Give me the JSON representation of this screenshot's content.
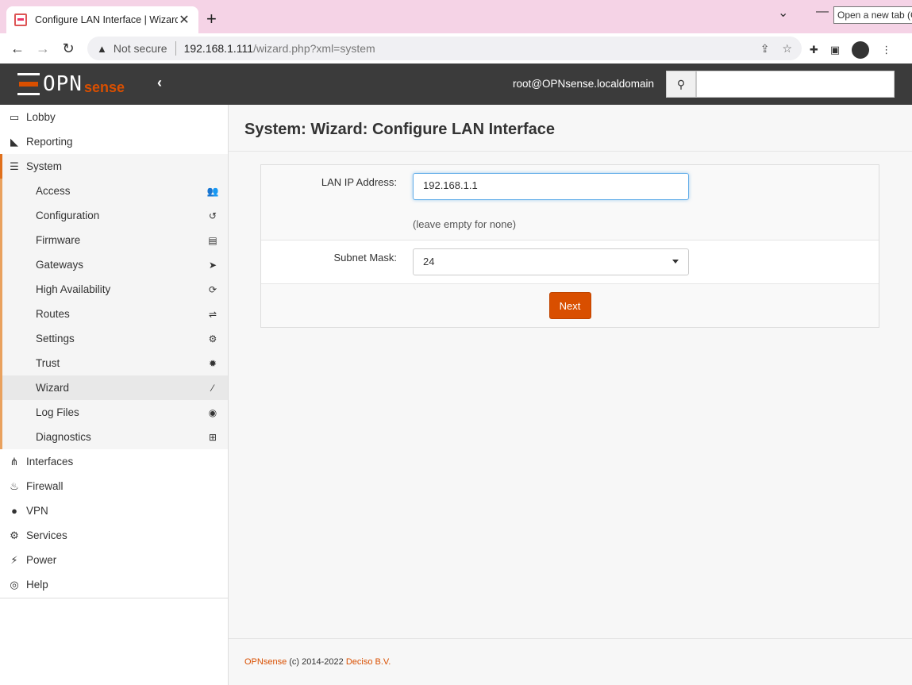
{
  "browser": {
    "tab_title": "Configure LAN Interface | Wizard",
    "tooltip": "Open a new tab (Ctrl+T)",
    "url_security": "Not secure",
    "url_host": "192.168.1.111",
    "url_path": "/wizard.php?xml=system"
  },
  "header": {
    "logo_opn": "OPN",
    "logo_sense": "sense",
    "user": "root@OPNsense.localdomain",
    "search_placeholder": ""
  },
  "sidebar": {
    "top_items": [
      {
        "label": "Lobby",
        "icon": "laptop-icon"
      },
      {
        "label": "Reporting",
        "icon": "area-chart-icon"
      },
      {
        "label": "System",
        "icon": "server-icon"
      }
    ],
    "system_subitems": [
      {
        "label": "Access",
        "icon": "users-icon"
      },
      {
        "label": "Configuration",
        "icon": "history-icon"
      },
      {
        "label": "Firmware",
        "icon": "building-icon"
      },
      {
        "label": "Gateways",
        "icon": "location-arrow-icon"
      },
      {
        "label": "High Availability",
        "icon": "refresh-icon"
      },
      {
        "label": "Routes",
        "icon": "map-signs-icon"
      },
      {
        "label": "Settings",
        "icon": "cogs-icon"
      },
      {
        "label": "Trust",
        "icon": "certificate-icon"
      },
      {
        "label": "Wizard",
        "icon": "magic-icon"
      },
      {
        "label": "Log Files",
        "icon": "eye-icon"
      },
      {
        "label": "Diagnostics",
        "icon": "medkit-icon"
      }
    ],
    "bottom_items": [
      {
        "label": "Interfaces",
        "icon": "sitemap-icon"
      },
      {
        "label": "Firewall",
        "icon": "fire-icon"
      },
      {
        "label": "VPN",
        "icon": "globe-icon"
      },
      {
        "label": "Services",
        "icon": "cog-icon"
      },
      {
        "label": "Power",
        "icon": "plug-icon"
      },
      {
        "label": "Help",
        "icon": "life-ring-icon"
      }
    ]
  },
  "main": {
    "title": "System: Wizard: Configure LAN Interface",
    "lan_ip_label": "LAN IP Address:",
    "lan_ip_value": "192.168.1.1",
    "lan_ip_hint": "(leave empty for none)",
    "subnet_label": "Subnet Mask:",
    "subnet_value": "24",
    "next_label": "Next"
  },
  "footer": {
    "brand": "OPNsense",
    "copyright": " (c) 2014-2022 ",
    "company": "Deciso B.V."
  },
  "colors": {
    "accent": "#d94f00",
    "header_bg": "#3b3b3b"
  }
}
